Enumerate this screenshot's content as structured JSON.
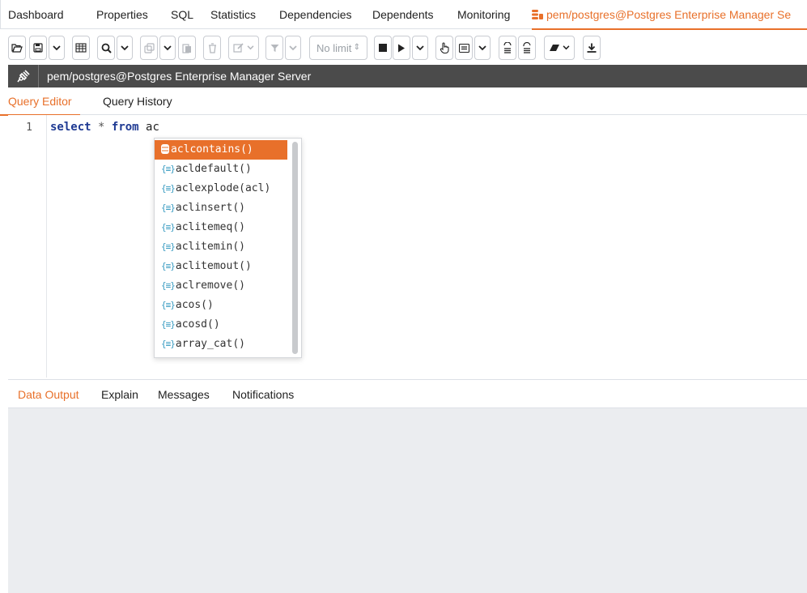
{
  "top_tabs": [
    {
      "label": "Dashboard"
    },
    {
      "label": "Properties"
    },
    {
      "label": "SQL"
    },
    {
      "label": "Statistics"
    },
    {
      "label": "Dependencies"
    },
    {
      "label": "Dependents"
    },
    {
      "label": "Monitoring"
    },
    {
      "label": "pem/postgres@Postgres Enterprise Manager Se",
      "active": true
    }
  ],
  "toolbar": {
    "no_limit_label": "No limit",
    "icons": [
      "open-file-icon",
      "save-icon",
      "save-dropdown-icon",
      "table-icon",
      "find-icon",
      "find-dropdown-icon",
      "copy-icon",
      "copy-dropdown-icon",
      "paste-icon",
      "delete-icon",
      "edit-icon",
      "filter-icon",
      "filter-dropdown-icon",
      "limit-select",
      "stop-icon",
      "execute-icon",
      "execute-dropdown-icon",
      "explain-icon",
      "macros-icon",
      "macros-dropdown-icon",
      "commit-icon",
      "rollback-icon",
      "clear-icon",
      "download-icon"
    ]
  },
  "connection": {
    "title": "pem/postgres@Postgres Enterprise Manager Server"
  },
  "editor_tabs": [
    {
      "label": "Query Editor",
      "active": true
    },
    {
      "label": "Query History"
    }
  ],
  "editor": {
    "line_number": "1",
    "kw_select": "select",
    "op_star": "*",
    "kw_from": "from",
    "text_rest": "ac"
  },
  "autocomplete": {
    "items": [
      {
        "label": "aclcontains()",
        "selected": true
      },
      {
        "label": "acldefault()"
      },
      {
        "label": "aclexplode(acl)"
      },
      {
        "label": "aclinsert()"
      },
      {
        "label": "aclitemeq()"
      },
      {
        "label": "aclitemin()"
      },
      {
        "label": "aclitemout()"
      },
      {
        "label": "aclremove()"
      },
      {
        "label": "acos()"
      },
      {
        "label": "acosd()"
      },
      {
        "label": "array_cat()"
      }
    ],
    "function_icon": "{≡}"
  },
  "result_tabs": [
    {
      "label": "Data Output",
      "active": true
    },
    {
      "label": "Explain"
    },
    {
      "label": "Messages"
    },
    {
      "label": "Notifications"
    }
  ],
  "colors": {
    "accent": "#e8702a",
    "connbar_bg": "#4b4b4b",
    "result_area_bg": "#ebedf0"
  }
}
